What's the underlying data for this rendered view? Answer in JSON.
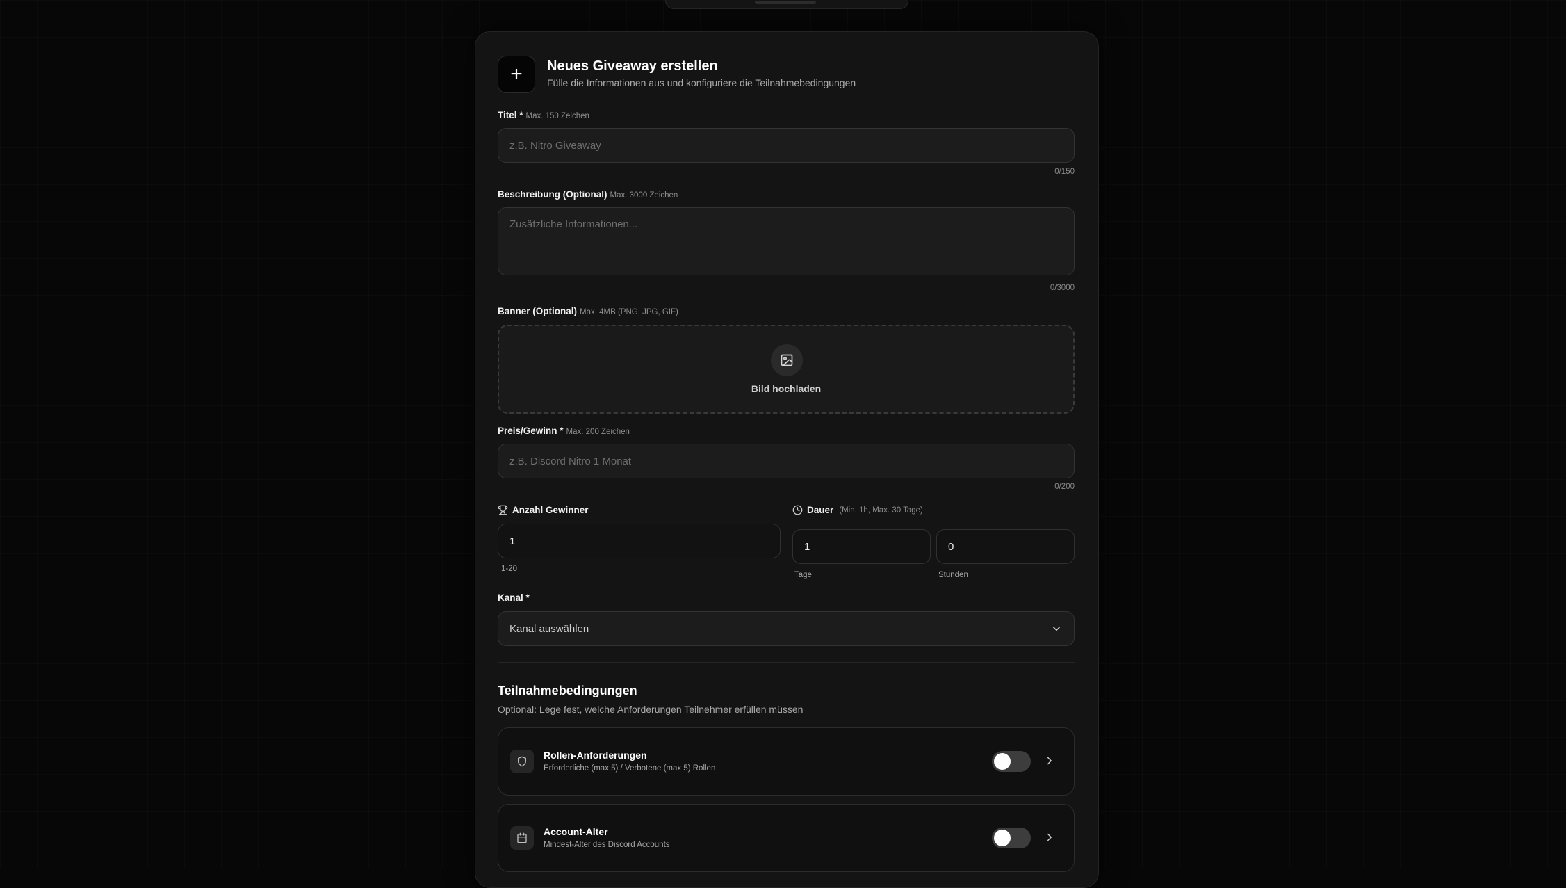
{
  "header": {
    "title": "Neues Giveaway erstellen",
    "subtitle": "Fülle die Informationen aus und konfiguriere die Teilnahmebedingungen",
    "icon": "plus-icon"
  },
  "form": {
    "title": {
      "label": "Titel *",
      "hint": "Max. 150 Zeichen",
      "placeholder": "z.B. Nitro Giveaway",
      "counter": "0/150"
    },
    "description": {
      "label": "Beschreibung (Optional)",
      "hint": "Max. 3000 Zeichen",
      "placeholder": "Zusätzliche Informationen...",
      "counter": "0/3000"
    },
    "banner": {
      "label": "Banner (Optional)",
      "hint": "Max. 4MB (PNG, JPG, GIF)",
      "upload_label": "Bild hochladen",
      "icon": "image-icon"
    },
    "prize": {
      "label": "Preis/Gewinn *",
      "hint": "Max. 200 Zeichen",
      "placeholder": "z.B. Discord Nitro 1 Monat",
      "counter": "0/200"
    },
    "winners": {
      "label": "Anzahl Gewinner",
      "icon": "trophy-icon",
      "value": "1",
      "range_note": "1-20"
    },
    "duration": {
      "label": "Dauer",
      "hint": "(Min. 1h, Max. 30 Tage)",
      "icon": "clock-icon",
      "days_value": "1",
      "days_label": "Tage",
      "hours_value": "0",
      "hours_label": "Stunden"
    },
    "channel": {
      "label": "Kanal *",
      "selected": "Kanal auswählen",
      "icon": "chevron-down-icon"
    }
  },
  "conditions": {
    "title": "Teilnahmebedingungen",
    "subtitle": "Optional: Lege fest, welche Anforderungen Teilnehmer erfüllen müssen",
    "items": [
      {
        "title": "Rollen-Anforderungen",
        "description": "Erforderliche (max 5) / Verbotene (max 5) Rollen",
        "icon": "shield-icon",
        "enabled": false
      },
      {
        "title": "Account-Alter",
        "description": "Mindest-Alter des Discord Accounts",
        "icon": "calendar-icon",
        "enabled": false
      }
    ]
  },
  "colors": {
    "background": "#070707",
    "card": "#141414",
    "input": "#1c1c1c",
    "accent": "#ffffff"
  }
}
